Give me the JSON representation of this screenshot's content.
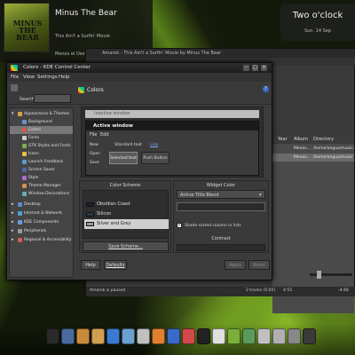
{
  "now_playing": {
    "cover_text": "MINUS THE BEAR",
    "artist": "Minus The Bear",
    "title": "This Ain't a Surfin' Movie",
    "album": "Menos el Oso"
  },
  "clock": {
    "time": "Two o'clock",
    "date": "Sun, 14 Sep"
  },
  "amarok": {
    "title": "Amarok - This Ain't a Surfin' Movie by Minus The Bear",
    "columns": [
      "Year",
      "Album",
      "Directory"
    ],
    "rows": [
      {
        "album": "Menos...",
        "directory": "/home/anguo/music...",
        "selected": false
      },
      {
        "album": "Menos...",
        "directory": "/home/anguo/music",
        "selected": true
      }
    ],
    "status": "Amarok is paused",
    "tracks": "2 tracks (5:05)",
    "elapsed": "4:55",
    "remaining": "-4:48"
  },
  "kcc": {
    "title": "Colors - KDE Control Center",
    "menu": [
      "File",
      "View",
      "Settings",
      "Help"
    ],
    "search_label": "Search:",
    "sidebar": {
      "tree": [
        {
          "label": "Appearance & Themes",
          "expanded": true,
          "icon": "appearance-icon",
          "color": "#d9a04a"
        },
        {
          "label": "Background",
          "icon": "background-icon",
          "color": "#6a8fcf"
        },
        {
          "label": "Colors",
          "icon": "colors-icon",
          "color": "#d4554a",
          "selected": true
        },
        {
          "label": "Fonts",
          "icon": "fonts-icon",
          "color": "#cccccc"
        },
        {
          "label": "GTK Styles and Fonts",
          "icon": "gtk-icon",
          "color": "#7fb04a"
        },
        {
          "label": "Icons",
          "icon": "icons-icon",
          "color": "#e0c040"
        },
        {
          "label": "Launch Feedback",
          "icon": "launch-icon",
          "color": "#5a9ad0"
        },
        {
          "label": "Screen Saver",
          "icon": "screensaver-icon",
          "color": "#4a6aa0"
        },
        {
          "label": "Style",
          "icon": "style-icon",
          "color": "#b06ad0"
        },
        {
          "label": "Theme Manager",
          "icon": "theme-icon",
          "color": "#d0904a"
        },
        {
          "label": "Window Decorations",
          "icon": "decorations-icon",
          "color": "#6ab0b0"
        },
        {
          "label": "Desktop",
          "expanded": false,
          "icon": "desktop-icon",
          "color": "#5a8ad0"
        },
        {
          "label": "Internet & Network",
          "expanded": false,
          "icon": "network-icon",
          "color": "#4aa0d0"
        },
        {
          "label": "KDE Components",
          "expanded": false,
          "icon": "components-icon",
          "color": "#6a9ae0"
        },
        {
          "label": "Peripherals",
          "expanded": false,
          "icon": "peripherals-icon",
          "color": "#9a9a9a"
        },
        {
          "label": "Regional & Accessibility",
          "expanded": false,
          "icon": "regional-icon",
          "color": "#d05a5a"
        }
      ]
    },
    "header": "Colors",
    "preview": {
      "inactive": "Inactive window",
      "active": "Active window",
      "menu": [
        "File",
        "Edit"
      ],
      "buttons": [
        "New",
        "Open",
        "Save"
      ],
      "standard_text": "Standard text",
      "link": "Link",
      "selected_text": "Selected text",
      "push_button": "Push Button"
    },
    "scheme": {
      "label": "Color Scheme",
      "items": [
        {
          "name": "Obsidian Coast",
          "swatch": "#1c2430"
        },
        {
          "name": "Silicon",
          "swatch": "#2a3a4a"
        },
        {
          "name": "Silver and Grey",
          "swatch": "#9a9a9a",
          "selected": true
        }
      ],
      "save": "Save Scheme..."
    },
    "widget": {
      "label": "Widget Color",
      "selected": "Active Title Blend",
      "shade_checked": true,
      "shade": "Shade sorted column in lists",
      "contrast": "Contrast"
    },
    "footer": {
      "help": "Help",
      "defaults": "Defaults",
      "apply": "Apply",
      "reset": "Reset"
    }
  },
  "taskbar": {
    "icons": [
      {
        "name": "kde-menu-icon",
        "color": "#2a2a2a"
      },
      {
        "name": "tools-icon",
        "color": "#4a6aa0"
      },
      {
        "name": "folder-icon",
        "color": "#c88a3a"
      },
      {
        "name": "home-icon",
        "color": "#d0a050"
      },
      {
        "name": "web-browser-icon",
        "color": "#3a7ad0"
      },
      {
        "name": "chat-icon",
        "color": "#6aa0d0"
      },
      {
        "name": "mail-icon",
        "color": "#c0c0c0"
      },
      {
        "name": "media-player-icon",
        "color": "#e08030"
      },
      {
        "name": "amarok-icon",
        "color": "#3a6ac8"
      },
      {
        "name": "photo-icon",
        "color": "#d04a4a"
      },
      {
        "name": "terminal-icon",
        "color": "#222222"
      },
      {
        "name": "calendar-icon",
        "color": "#e0e0e0"
      },
      {
        "name": "music-icon",
        "color": "#7ab03a"
      },
      {
        "name": "system-settings-icon",
        "color": "#5a9a5a"
      },
      {
        "name": "clock-icon",
        "color": "#c0c0c0"
      },
      {
        "name": "cd-icon",
        "color": "#b0b0b0"
      },
      {
        "name": "trash-icon",
        "color": "#888888"
      },
      {
        "name": "shutdown-icon",
        "color": "#3a3a3a"
      }
    ]
  }
}
